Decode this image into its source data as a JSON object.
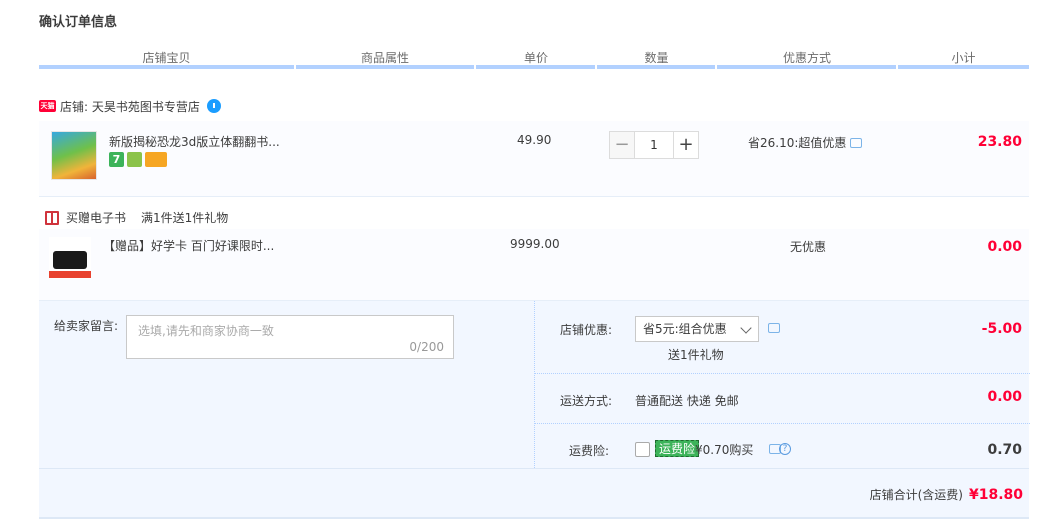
{
  "page": {
    "title": "确认订单信息"
  },
  "columns": [
    "店铺宝贝",
    "商品属性",
    "单价",
    "数量",
    "优惠方式",
    "小计"
  ],
  "colors": {
    "accent_red": "#ff0036",
    "header_line": "#b2d1ff",
    "panel_bg": "#f2f7ff"
  },
  "shop": {
    "badge": "天猫",
    "name": "店铺: 天昊书苑图书专营店",
    "chat_icon": "chat-bubble-icon"
  },
  "item": {
    "title": "新版揭秘恐龙3d版立体翻翻书...",
    "service_badge": "7",
    "unit_price": "49.90",
    "quantity": "1",
    "promo": "省26.10:超值优惠",
    "subtotal": "23.80"
  },
  "gift": {
    "header": "买赠电子书",
    "rule": "满1件送1件礼物",
    "title": "【赠品】好学卡 百门好课限时...",
    "price": "9999.00",
    "promo": "无优惠",
    "subtotal": "0.00"
  },
  "memo": {
    "label": "给卖家留言:",
    "placeholder": "选填,请先和商家协商一致",
    "counter": "0/200"
  },
  "shop_discount": {
    "label": "店铺优惠:",
    "selected": "省5元:组合优惠",
    "note": "送1件礼物",
    "amount": "-5.00"
  },
  "shipping": {
    "label": "运送方式:",
    "value": "普通配送 快递 免邮",
    "amount": "0.00"
  },
  "insurance": {
    "label": "运费险:",
    "tag": "运费险",
    "price": "¥0.70购买",
    "help": "?",
    "amount": "0.70",
    "checked": false
  },
  "total": {
    "label": "店铺合计(含运费)",
    "amount": "¥18.80"
  }
}
